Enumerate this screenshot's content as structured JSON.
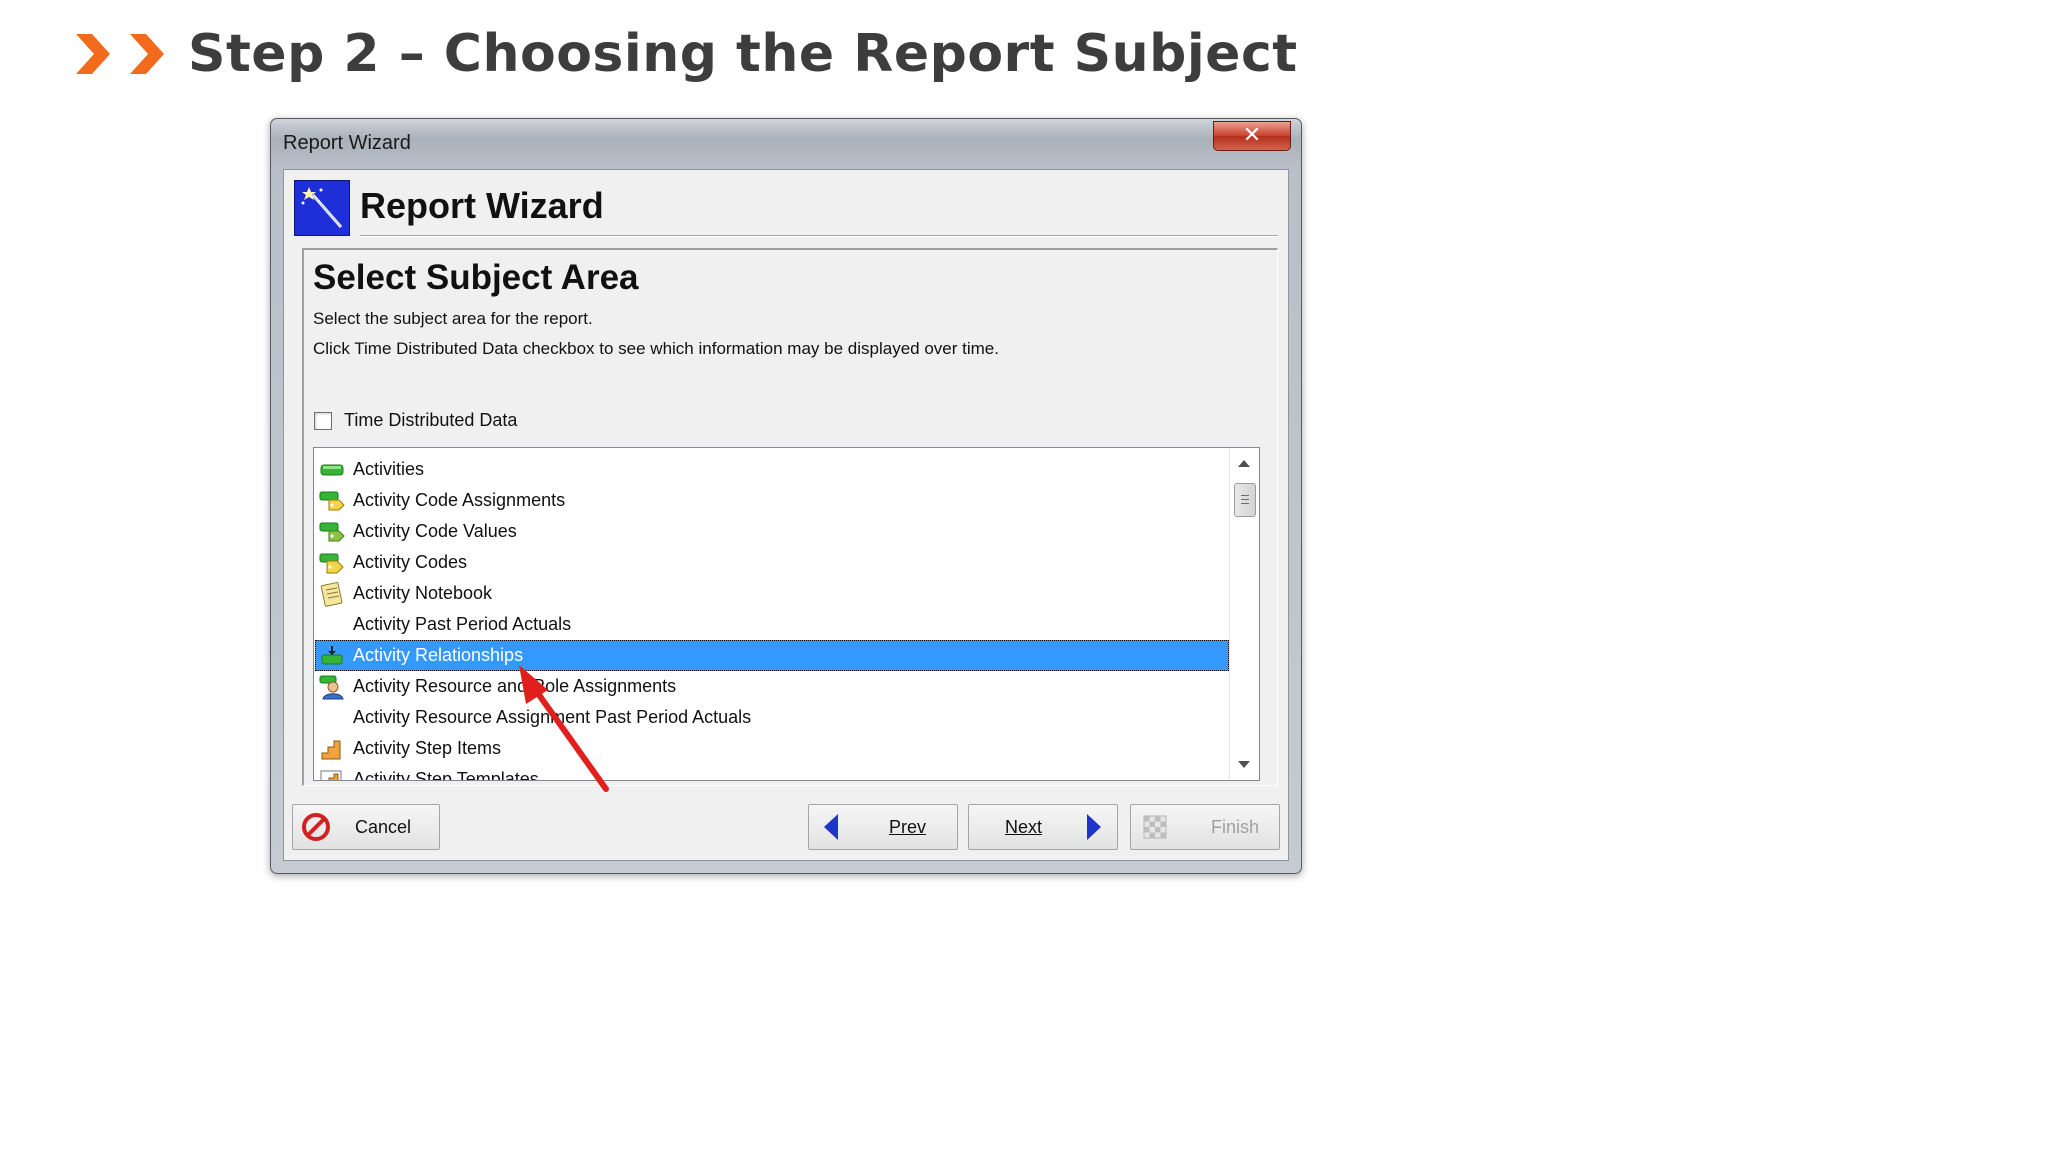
{
  "slide": {
    "title": "Step 2 – Choosing the Report Subject",
    "accent_color": "#f26b1d"
  },
  "window": {
    "title": "Report Wizard",
    "close_glyph": "✕"
  },
  "wizard": {
    "banner_title": "Report Wizard",
    "section_title": "Select Subject Area",
    "instruction_1": "Select the subject area for the report.",
    "instruction_2": "Click Time Distributed Data checkbox to see which information may be displayed over time.",
    "time_distributed_label": "Time Distributed Data",
    "time_distributed_checked": false,
    "selection_color": "#3399ff",
    "subject_areas": [
      {
        "label": "Activities",
        "icon": "activity-bar-icon",
        "selected": false
      },
      {
        "label": "Activity Code Assignments",
        "icon": "activity-code-assignment-icon",
        "selected": false
      },
      {
        "label": "Activity Code Values",
        "icon": "activity-code-value-icon",
        "selected": false
      },
      {
        "label": "Activity Codes",
        "icon": "activity-code-icon",
        "selected": false
      },
      {
        "label": "Activity Notebook",
        "icon": "notebook-icon",
        "selected": false
      },
      {
        "label": "Activity Past Period Actuals",
        "icon": "",
        "selected": false
      },
      {
        "label": "Activity Relationships",
        "icon": "relationship-icon",
        "selected": true
      },
      {
        "label": "Activity Resource and Role Assignments",
        "icon": "resource-assignment-icon",
        "selected": false
      },
      {
        "label": "Activity Resource Assignment Past Period Actuals",
        "icon": "",
        "selected": false
      },
      {
        "label": "Activity Step Items",
        "icon": "step-items-icon",
        "selected": false
      },
      {
        "label": "Activity Step Templates",
        "icon": "step-templates-icon",
        "selected": false
      }
    ]
  },
  "buttons": {
    "cancel": "Cancel",
    "prev": "Prev",
    "next": "Next",
    "finish": "Finish"
  }
}
